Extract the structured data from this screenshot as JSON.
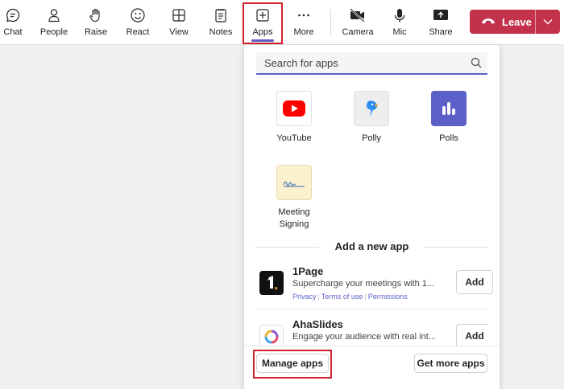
{
  "toolbar": {
    "items": [
      {
        "label": "Chat",
        "icon": "chat-icon"
      },
      {
        "label": "People",
        "icon": "people-icon"
      },
      {
        "label": "Raise",
        "icon": "raise-hand-icon"
      },
      {
        "label": "React",
        "icon": "smiley-icon"
      },
      {
        "label": "View",
        "icon": "grid-icon"
      },
      {
        "label": "Notes",
        "icon": "notes-icon"
      },
      {
        "label": "Apps",
        "icon": "plus-square-icon"
      },
      {
        "label": "More",
        "icon": "more-icon"
      },
      {
        "label": "Camera",
        "icon": "camera-off-icon"
      },
      {
        "label": "Mic",
        "icon": "mic-icon"
      },
      {
        "label": "Share",
        "icon": "share-icon"
      }
    ],
    "leave_label": "Leave"
  },
  "panel": {
    "search_placeholder": "Search for apps",
    "apps": [
      {
        "name": "YouTube"
      },
      {
        "name": "Polly"
      },
      {
        "name": "Polls"
      },
      {
        "name": "Meeting Signing"
      }
    ],
    "section_title": "Add a new app",
    "new_apps": [
      {
        "title": "1Page",
        "desc": "Supercharge your meetings with 1...",
        "links": [
          "Privacy",
          "Terms of use",
          "Permissions"
        ],
        "add_label": "Add"
      },
      {
        "title": "AhaSlides",
        "desc": "Engage your audience with real int...",
        "add_label": "Add"
      }
    ],
    "footer": {
      "manage_label": "Manage apps",
      "get_more_label": "Get more apps"
    }
  },
  "colors": {
    "accent": "#5b5fc7",
    "leave": "#c4314b",
    "highlight": "#d0222b"
  }
}
